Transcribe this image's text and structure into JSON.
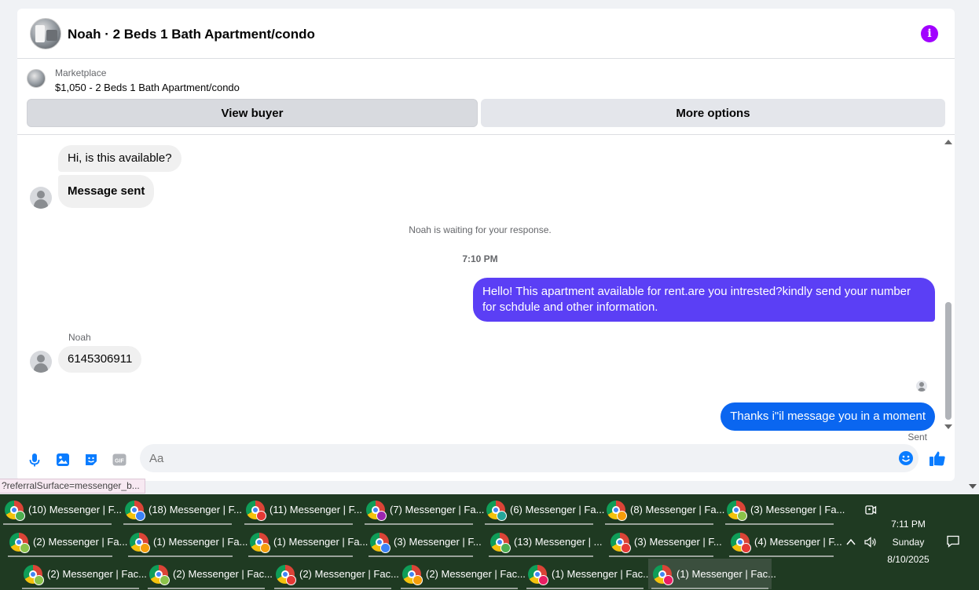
{
  "header": {
    "title": "Noah · 2 Beds 1 Bath Apartment/condo",
    "info_icon": "info-icon",
    "info_color": "#a100ff"
  },
  "marketplace": {
    "label": "Marketplace",
    "listing": "$1,050 - 2 Beds 1 Bath Apartment/condo",
    "view_buyer_label": "View buyer",
    "more_options_label": "More options"
  },
  "messages": {
    "in_1": "Hi, is this available?",
    "in_2": "Message sent",
    "system_note": "Noah is waiting for your response.",
    "timestamp": "7:10 PM",
    "out_1": "Hello! This apartment available for rent.are you intrested?kindly send your number for schdule and other information.",
    "sender_name": "Noah",
    "in_3": "6145306911",
    "out_2": "Thanks i\"il message you in a moment",
    "sent_status": "Sent",
    "out_color_1": "#5b3ff5",
    "out_color_2": "#0a66f0"
  },
  "composer": {
    "placeholder": "Aa",
    "icons": [
      "microphone-icon",
      "photo-icon",
      "sticker-icon",
      "gif-icon",
      "emoji-icon",
      "thumbs-up-icon"
    ],
    "gif_label": "GIF",
    "accent": "#0a7cff"
  },
  "status_url": "?referralSurface=messenger_b...",
  "taskbar": {
    "row1": [
      {
        "label": "(10) Messenger | F...",
        "badge": "#4caf50"
      },
      {
        "label": "(18) Messenger | F...",
        "badge": "#3b82f6"
      },
      {
        "label": "(11) Messenger | F...",
        "badge": "#e53935"
      },
      {
        "label": "(7) Messenger | Fa...",
        "badge": "#9c27b0"
      },
      {
        "label": "(6) Messenger | Fa...",
        "badge": "#26a69a"
      },
      {
        "label": "(8) Messenger | Fa...",
        "badge": "#f59e0b"
      },
      {
        "label": "(3) Messenger | Fa...",
        "badge": "#8bc34a"
      }
    ],
    "row2": [
      {
        "label": "(2) Messenger | Fa...",
        "badge": "#8bc34a"
      },
      {
        "label": "(1) Messenger | Fa...",
        "badge": "#f59e0b"
      },
      {
        "label": "(1) Messenger | Fa...",
        "badge": "#f59e0b"
      },
      {
        "label": "(3) Messenger | F...",
        "badge": "#3b82f6"
      },
      {
        "label": "(13) Messenger | ...",
        "badge": "#4caf50"
      },
      {
        "label": "(3) Messenger | F...",
        "badge": "#e53935"
      },
      {
        "label": "(4) Messenger | F...",
        "badge": "#e53935"
      }
    ],
    "row3": [
      {
        "label": "(2) Messenger | Fac...",
        "badge": "#8bc34a",
        "active": false
      },
      {
        "label": "(2) Messenger | Fac...",
        "badge": "#8bc34a",
        "active": false
      },
      {
        "label": "(2) Messenger | Fac...",
        "badge": "#e53935",
        "active": false
      },
      {
        "label": "(2) Messenger | Fac...",
        "badge": "#f59e0b",
        "active": false
      },
      {
        "label": "(1) Messenger | Fac...",
        "badge": "#e91e63",
        "active": false
      },
      {
        "label": "(1) Messenger | Fac...",
        "badge": "#e91e63",
        "active": true
      }
    ],
    "clock_time": "7:11 PM",
    "clock_day": "Sunday",
    "clock_date": "8/10/2025",
    "tray_icons": [
      "meet-now-icon",
      "chevron-up-icon",
      "volume-icon",
      "notification-icon"
    ]
  }
}
